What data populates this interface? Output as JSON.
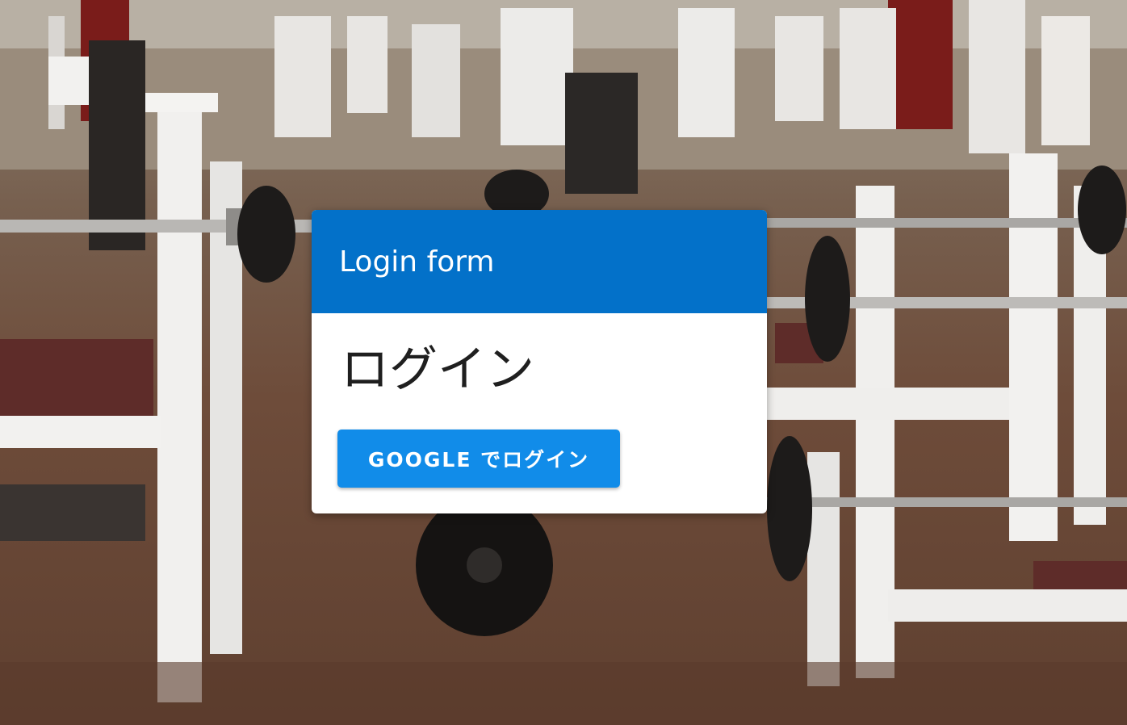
{
  "background": {
    "description_icon": "gym-photo"
  },
  "login_card": {
    "header_title": "Login form",
    "heading": "ログイン",
    "google_button_label": "GOOGLE でログイン"
  },
  "colors": {
    "header": "#0371c9",
    "button": "#118ce9",
    "card": "#ffffff"
  }
}
